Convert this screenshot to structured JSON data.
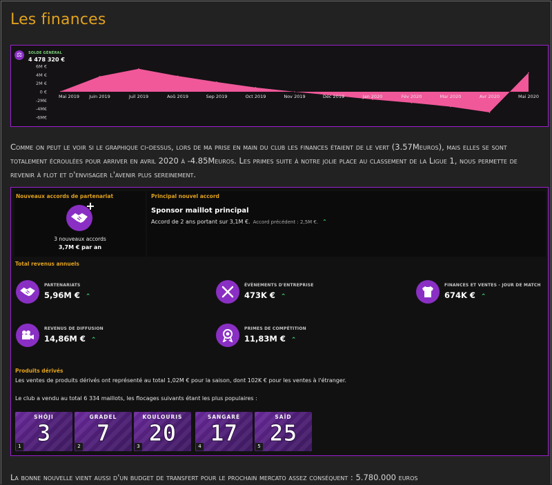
{
  "page": {
    "title": "Les finances"
  },
  "chart": {
    "legend_label": "SOLDE GÉNÉRAL",
    "legend_value": "4 478 320 €",
    "legend_icon": "balance-icon",
    "fill_color": "#f0589a",
    "y_ticks": [
      "6M €",
      "4M €",
      "2M €",
      "0 €",
      "-2M€",
      "-4M€",
      "-6M€"
    ],
    "x_ticks": [
      "Mai 2019",
      "Juin 2019",
      "Juil 2019",
      "Aoû 2019",
      "Sep 2019",
      "Oct 2019",
      "Nov 2019",
      "Déc 2019",
      "Jan 2020",
      "Fév 2020",
      "Mar 2020",
      "Avr 2020",
      "Mai 2020"
    ]
  },
  "chart_data": {
    "type": "area",
    "title": "",
    "xlabel": "",
    "ylabel": "",
    "categories": [
      "Mai 2019",
      "Juin 2019",
      "Juil 2019",
      "Aoû 2019",
      "Sep 2019",
      "Oct 2019",
      "Nov 2019",
      "Déc 2019",
      "Jan 2020",
      "Fév 2020",
      "Mar 2020",
      "Avr 2020",
      "Mai 2020"
    ],
    "series": [
      {
        "name": "SOLDE GÉNÉRAL",
        "values": [
          0.1,
          3.6,
          5.4,
          3.7,
          2.3,
          1.0,
          0.0,
          -0.9,
          -1.8,
          -2.6,
          -3.5,
          -4.85,
          4.48
        ]
      }
    ],
    "ylim": [
      -6,
      6
    ],
    "grid": false
  },
  "paragraphs": {
    "intro": "Comme on peut le voir si le graphique ci-dessus, lors de ma prise en main du club les finances étaient de le vert (3.57Meuros), mais elles se sont totalement écroulées pour arriver en avril 2020 à -4.85Meuros. Les primes suite à notre jolie place au classement de la Ligue 1, nous permette de revenir à flot et d'envisager l'avenir plus sereinement.",
    "outro": "La bonne nouvelle vient aussi d'un budget de transfert pour le prochain mercato assez conséquent : 5.780.000 euros"
  },
  "partnership": {
    "section_label": "Nouveaux accords de partenariat",
    "count_text": "3 nouveaux accords",
    "amount_text": "3,7M € par an",
    "icon": "handshake-icon"
  },
  "main_deal": {
    "section_label": "Principal nouvel accord",
    "name": "Sponsor maillot principal",
    "description": "Accord de 2 ans portant sur 3,1M €.",
    "previous": "Accord précédent : 2,5M €.",
    "arrow": "⌃"
  },
  "revenues": {
    "section_label": "Total revenus annuels",
    "items": [
      {
        "label": "PARTENARIATS",
        "value": "5,96M €",
        "icon": "handshake-icon",
        "arrow": "⌃"
      },
      {
        "label": "ÉVÈNEMENTS D'ENTREPRISE",
        "value": "473K €",
        "icon": "cutlery-icon",
        "arrow": "⌃"
      },
      {
        "label": "FINANCES ET VENTES - JOUR DE MATCH",
        "value": "674K €",
        "icon": "shirt-icon",
        "arrow": "⌃"
      },
      {
        "label": "REVENUS DE DIFFUSION",
        "value": "14,86M €",
        "icon": "camera-icon",
        "arrow": "⌃"
      },
      {
        "label": "PRIMES DE COMPÉTITION",
        "value": "11,83M €",
        "icon": "medal-icon",
        "arrow": "⌃"
      }
    ]
  },
  "merch": {
    "section_label": "Produits dérivés",
    "line1": "Les ventes de produits dérivés ont représenté au total 1,02M € pour la saison, dont 102K € pour les ventes à l'étranger.",
    "line2": "Le club a vendu au total 6 334 maillots, les flocages suivants étant les plus populaires :",
    "jerseys": [
      {
        "name": "SHÔJI",
        "number": "3",
        "rank": "1"
      },
      {
        "name": "GRADEL",
        "number": "7",
        "rank": "2"
      },
      {
        "name": "KOULOURIS",
        "number": "20",
        "rank": "3"
      },
      {
        "name": "SANGARÉ",
        "number": "17",
        "rank": "4"
      },
      {
        "name": "SAÏD",
        "number": "25",
        "rank": "5"
      }
    ]
  }
}
